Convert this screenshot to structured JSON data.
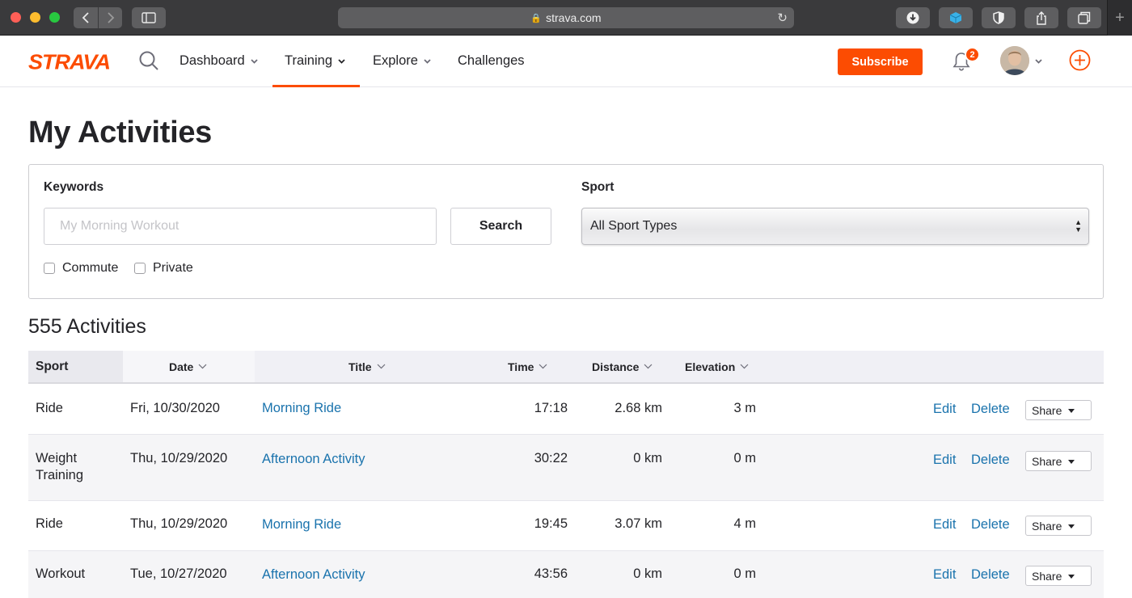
{
  "browser": {
    "url": "strava.com"
  },
  "nav": {
    "logo": "STRAVA",
    "items": [
      {
        "label": "Dashboard"
      },
      {
        "label": "Training"
      },
      {
        "label": "Explore"
      },
      {
        "label": "Challenges"
      }
    ],
    "active": "Training",
    "subscribe_label": "Subscribe",
    "notification_count": "2",
    "accent_color": "#fc4c02"
  },
  "page": {
    "title": "My Activities"
  },
  "filters": {
    "keywords_label": "Keywords",
    "keywords_placeholder": "My Morning Workout",
    "keywords_value": "",
    "search_label": "Search",
    "sport_label": "Sport",
    "sport_selected": "All Sport Types",
    "commute_label": "Commute",
    "private_label": "Private"
  },
  "summary": {
    "count_text": "555 Activities"
  },
  "table": {
    "columns": [
      "Sport",
      "Date",
      "Title",
      "Time",
      "Distance",
      "Elevation"
    ],
    "edit_label": "Edit",
    "delete_label": "Delete",
    "share_label": "Share",
    "rows": [
      {
        "sport": "Ride",
        "date": "Fri, 10/30/2020",
        "title": "Morning Ride",
        "time": "17:18",
        "distance": "2.68 km",
        "elevation": "3 m"
      },
      {
        "sport": "Weight Training",
        "date": "Thu, 10/29/2020",
        "title": "Afternoon Activity",
        "time": "30:22",
        "distance": "0 km",
        "elevation": "0 m"
      },
      {
        "sport": "Ride",
        "date": "Thu, 10/29/2020",
        "title": "Morning Ride",
        "time": "19:45",
        "distance": "3.07 km",
        "elevation": "4 m"
      },
      {
        "sport": "Workout",
        "date": "Tue, 10/27/2020",
        "title": "Afternoon Activity",
        "time": "43:56",
        "distance": "0 km",
        "elevation": "0 m"
      }
    ]
  }
}
